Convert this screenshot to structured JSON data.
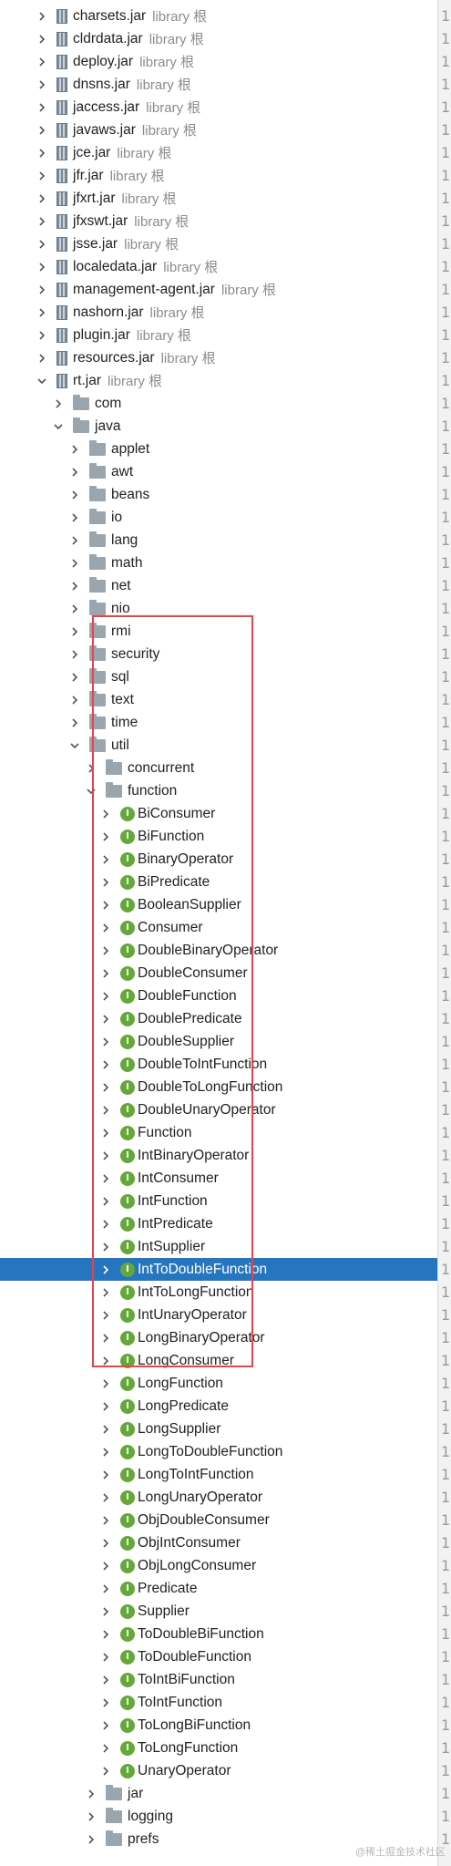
{
  "secondary_label": "library 根",
  "watermark": "@稀土掘金技术社区",
  "gutter_glyph": "1",
  "jars": [
    "charsets.jar",
    "cldrdata.jar",
    "deploy.jar",
    "dnsns.jar",
    "jaccess.jar",
    "javaws.jar",
    "jce.jar",
    "jfr.jar",
    "jfxrt.jar",
    "jfxswt.jar",
    "jsse.jar",
    "localedata.jar",
    "management-agent.jar",
    "nashorn.jar",
    "plugin.jar",
    "resources.jar"
  ],
  "rt_jar": {
    "label": "rt.jar",
    "secondary": "library 根"
  },
  "rt_children": [
    "com",
    "java"
  ],
  "java_packages": [
    "applet",
    "awt",
    "beans",
    "io",
    "lang",
    "math",
    "net",
    "nio",
    "rmi",
    "security",
    "sql",
    "text",
    "time",
    "util"
  ],
  "util_children": [
    "concurrent",
    "function"
  ],
  "function_interfaces": [
    "BiConsumer",
    "BiFunction",
    "BinaryOperator",
    "BiPredicate",
    "BooleanSupplier",
    "Consumer",
    "DoubleBinaryOperator",
    "DoubleConsumer",
    "DoubleFunction",
    "DoublePredicate",
    "DoubleSupplier",
    "DoubleToIntFunction",
    "DoubleToLongFunction",
    "DoubleUnaryOperator",
    "Function",
    "IntBinaryOperator",
    "IntConsumer",
    "IntFunction",
    "IntPredicate",
    "IntSupplier",
    "IntToDoubleFunction",
    "IntToLongFunction",
    "IntUnaryOperator",
    "LongBinaryOperator",
    "LongConsumer",
    "LongFunction",
    "LongPredicate",
    "LongSupplier",
    "LongToDoubleFunction",
    "LongToIntFunction",
    "LongUnaryOperator",
    "ObjDoubleConsumer",
    "ObjIntConsumer",
    "ObjLongConsumer",
    "Predicate",
    "Supplier",
    "ToDoubleBiFunction",
    "ToDoubleFunction",
    "ToIntBiFunction",
    "ToIntFunction",
    "ToLongBiFunction",
    "ToLongFunction",
    "UnaryOperator"
  ],
  "selected_interface": "IntToDoubleFunction",
  "util_after": [
    "jar",
    "logging",
    "prefs"
  ],
  "interface_badge": "I",
  "colors": {
    "selection": "#2675bf",
    "highlight_box": "#e8434a",
    "interface_icon": "#64a83a"
  }
}
